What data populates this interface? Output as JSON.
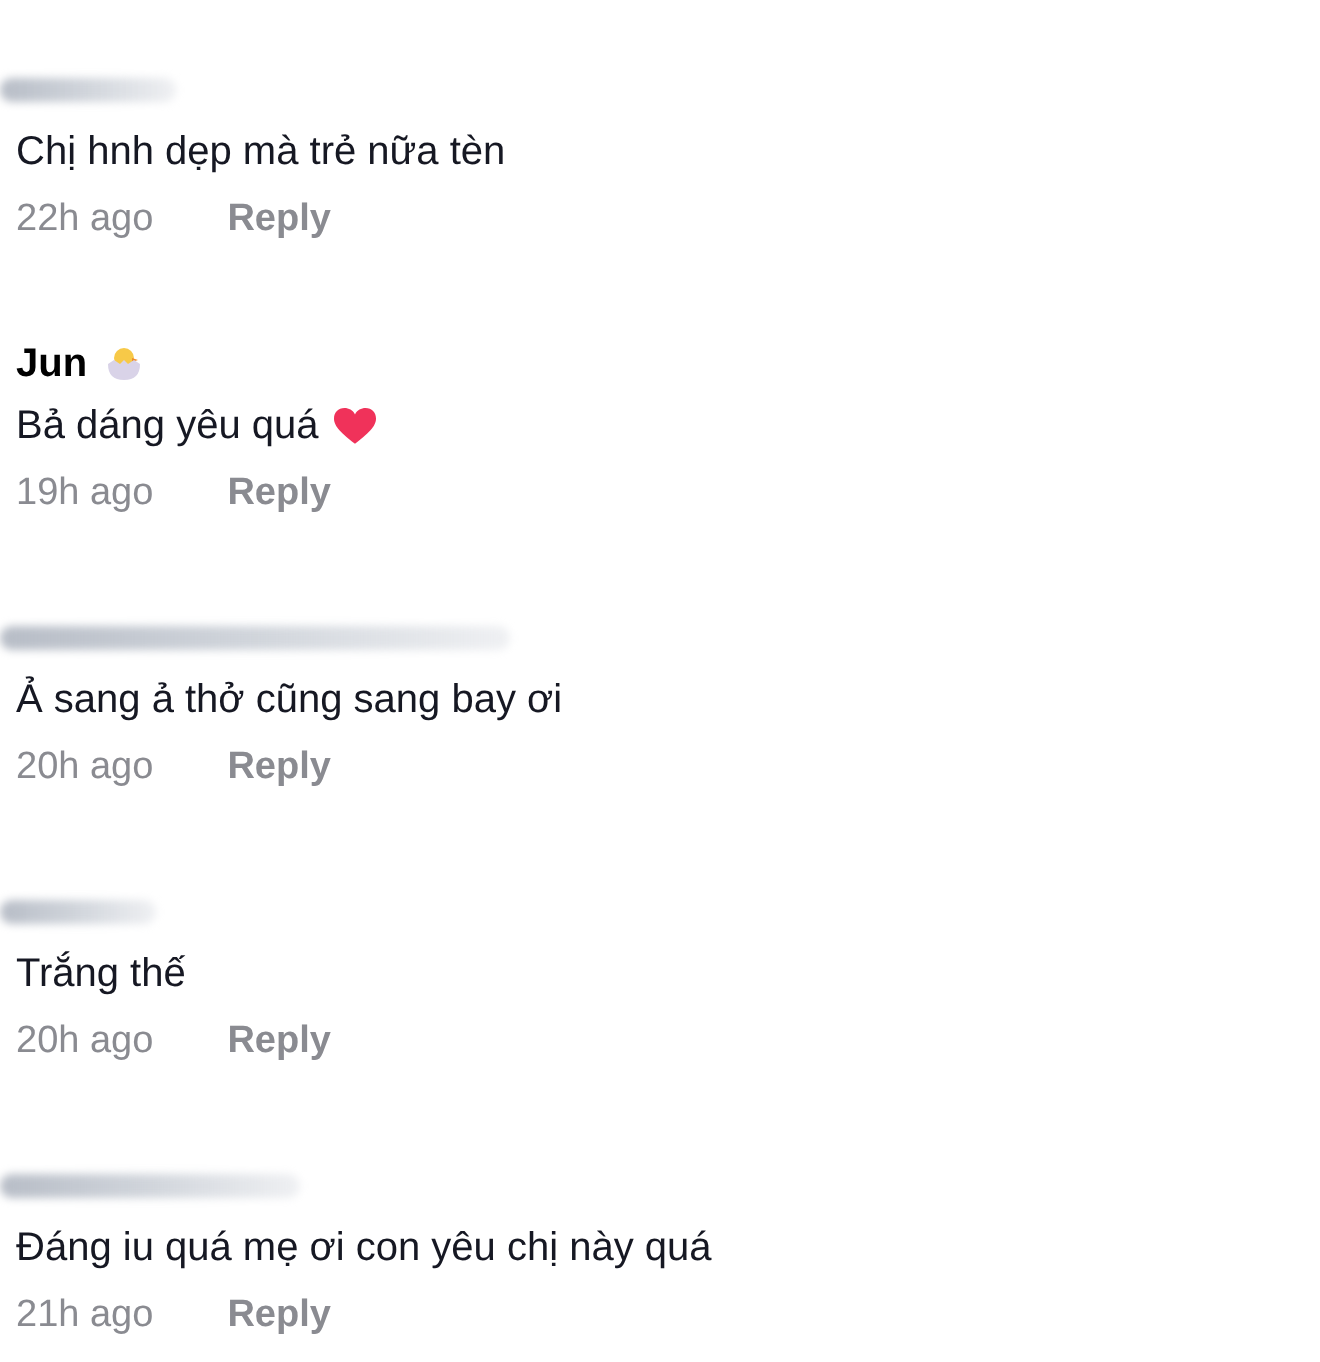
{
  "comments": [
    {
      "author": {
        "kind": "blurred"
      },
      "text": "Chị hnh dẹp mà trẻ nữa tèn",
      "time": "22h ago",
      "reply": "Reply",
      "heart": false
    },
    {
      "author": {
        "kind": "name",
        "name": "Jun",
        "badge": true
      },
      "text": "Bả dáng yêu quá",
      "time": "19h ago",
      "reply": "Reply",
      "heart": true
    },
    {
      "author": {
        "kind": "blurred"
      },
      "text": "Ả sang ả thở cũng sang bay ơi",
      "time": "20h ago",
      "reply": "Reply",
      "heart": false
    },
    {
      "author": {
        "kind": "blurred"
      },
      "text": "Trắng thế",
      "time": "20h ago",
      "reply": "Reply",
      "heart": false
    },
    {
      "author": {
        "kind": "blurred"
      },
      "text": "Đáng iu quá mẹ ơi con yêu chị này quá",
      "time": "21h ago",
      "reply": "Reply",
      "heart": false
    }
  ]
}
